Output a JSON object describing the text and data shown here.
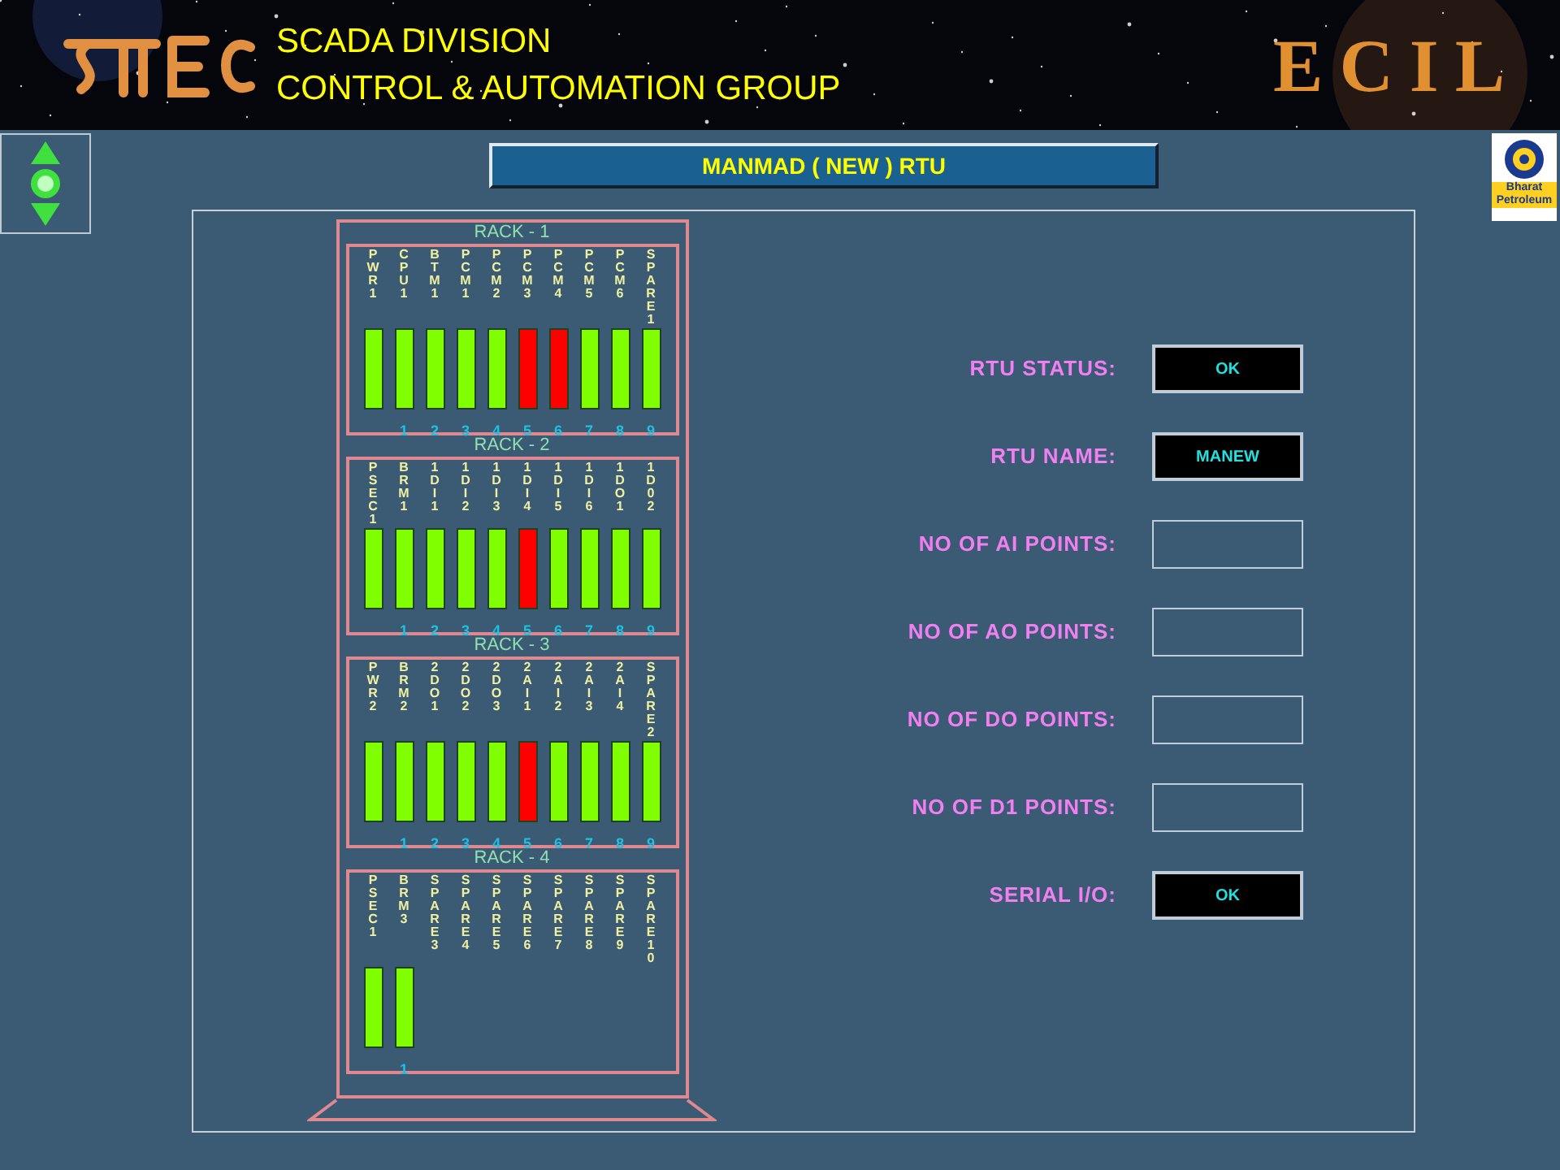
{
  "header": {
    "line_1": "SCADA DIVISION",
    "line_2": "CONTROL & AUTOMATION GROUP",
    "brand": "ECIL"
  },
  "title": "MANMAD ( NEW ) RTU",
  "partner_logo": {
    "line_1": "Bharat",
    "line_2": "Petroleum"
  },
  "racks": [
    {
      "title": "RACK - 1",
      "modules": [
        {
          "label": "PWR1",
          "kind": "card",
          "fault": false
        },
        {
          "label": "CPU1",
          "kind": "card",
          "fault": false,
          "number": "1"
        },
        {
          "label": "BTM1",
          "kind": "card",
          "fault": false,
          "number": "2"
        },
        {
          "label": "PCM1",
          "kind": "card",
          "fault": false,
          "number": "3"
        },
        {
          "label": "PCM2",
          "kind": "card",
          "fault": false,
          "number": "4"
        },
        {
          "label": "PCM3",
          "kind": "card",
          "fault": true,
          "number": "5"
        },
        {
          "label": "PCM4",
          "kind": "card",
          "fault": true,
          "number": "6"
        },
        {
          "label": "PCM5",
          "kind": "card",
          "fault": false,
          "number": "7"
        },
        {
          "label": "PCM6",
          "kind": "card",
          "fault": false,
          "number": "8"
        },
        {
          "label": "SPARE1",
          "kind": "card",
          "fault": false,
          "number": "9"
        }
      ]
    },
    {
      "title": "RACK - 2",
      "modules": [
        {
          "label": "PSEC1",
          "kind": "card",
          "fault": false
        },
        {
          "label": "BRM1",
          "kind": "card",
          "fault": false,
          "number": "1"
        },
        {
          "label": "1DI1",
          "kind": "card",
          "fault": false,
          "number": "2"
        },
        {
          "label": "1DI2",
          "kind": "card",
          "fault": false,
          "number": "3"
        },
        {
          "label": "1DI3",
          "kind": "card",
          "fault": false,
          "number": "4"
        },
        {
          "label": "1DI4",
          "kind": "card",
          "fault": true,
          "number": "5"
        },
        {
          "label": "1DI5",
          "kind": "card",
          "fault": false,
          "number": "6"
        },
        {
          "label": "1DI6",
          "kind": "card",
          "fault": false,
          "number": "7"
        },
        {
          "label": "1DO1",
          "kind": "card",
          "fault": false,
          "number": "8"
        },
        {
          "label": "1D02",
          "kind": "card",
          "fault": false,
          "number": "9"
        }
      ]
    },
    {
      "title": "RACK - 3",
      "modules": [
        {
          "label": "PWR2",
          "kind": "card",
          "fault": false
        },
        {
          "label": "BRM2",
          "kind": "card",
          "fault": false,
          "number": "1"
        },
        {
          "label": "2DO1",
          "kind": "card",
          "fault": false,
          "number": "2"
        },
        {
          "label": "2DO2",
          "kind": "card",
          "fault": false,
          "number": "3"
        },
        {
          "label": "2DO3",
          "kind": "card",
          "fault": false,
          "number": "4"
        },
        {
          "label": "2AI1",
          "kind": "card",
          "fault": true,
          "number": "5"
        },
        {
          "label": "2AI2",
          "kind": "card",
          "fault": false,
          "number": "6"
        },
        {
          "label": "2AI3",
          "kind": "card",
          "fault": false,
          "number": "7"
        },
        {
          "label": "2AI4",
          "kind": "card",
          "fault": false,
          "number": "8"
        },
        {
          "label": "SPARE2",
          "kind": "card",
          "fault": false,
          "number": "9"
        }
      ]
    },
    {
      "title": "RACK - 4",
      "modules": [
        {
          "label": "PSEC1",
          "kind": "card",
          "fault": false
        },
        {
          "label": "BRM3",
          "kind": "card",
          "fault": false,
          "number": "1"
        },
        {
          "label": "SPARE3",
          "kind": "empty"
        },
        {
          "label": "SPARE4",
          "kind": "empty"
        },
        {
          "label": "SPARE5",
          "kind": "empty"
        },
        {
          "label": "SPARE6",
          "kind": "empty"
        },
        {
          "label": "SPARE7",
          "kind": "empty"
        },
        {
          "label": "SPARE8",
          "kind": "empty"
        },
        {
          "label": "SPARE9",
          "kind": "empty"
        },
        {
          "label": "SPARE10",
          "kind": "empty"
        }
      ]
    }
  ],
  "fields": [
    {
      "label": "RTU STATUS:",
      "value": "OK"
    },
    {
      "label": "RTU NAME:",
      "value": "MANEW"
    },
    {
      "label": "NO OF AI POINTS:"
    },
    {
      "label": "NO OF AO POINTS:"
    },
    {
      "label": "NO OF DO POINTS:"
    },
    {
      "label": "NO OF D1 POINTS:"
    },
    {
      "label": "SERIAL I/O:",
      "value": "OK"
    }
  ]
}
